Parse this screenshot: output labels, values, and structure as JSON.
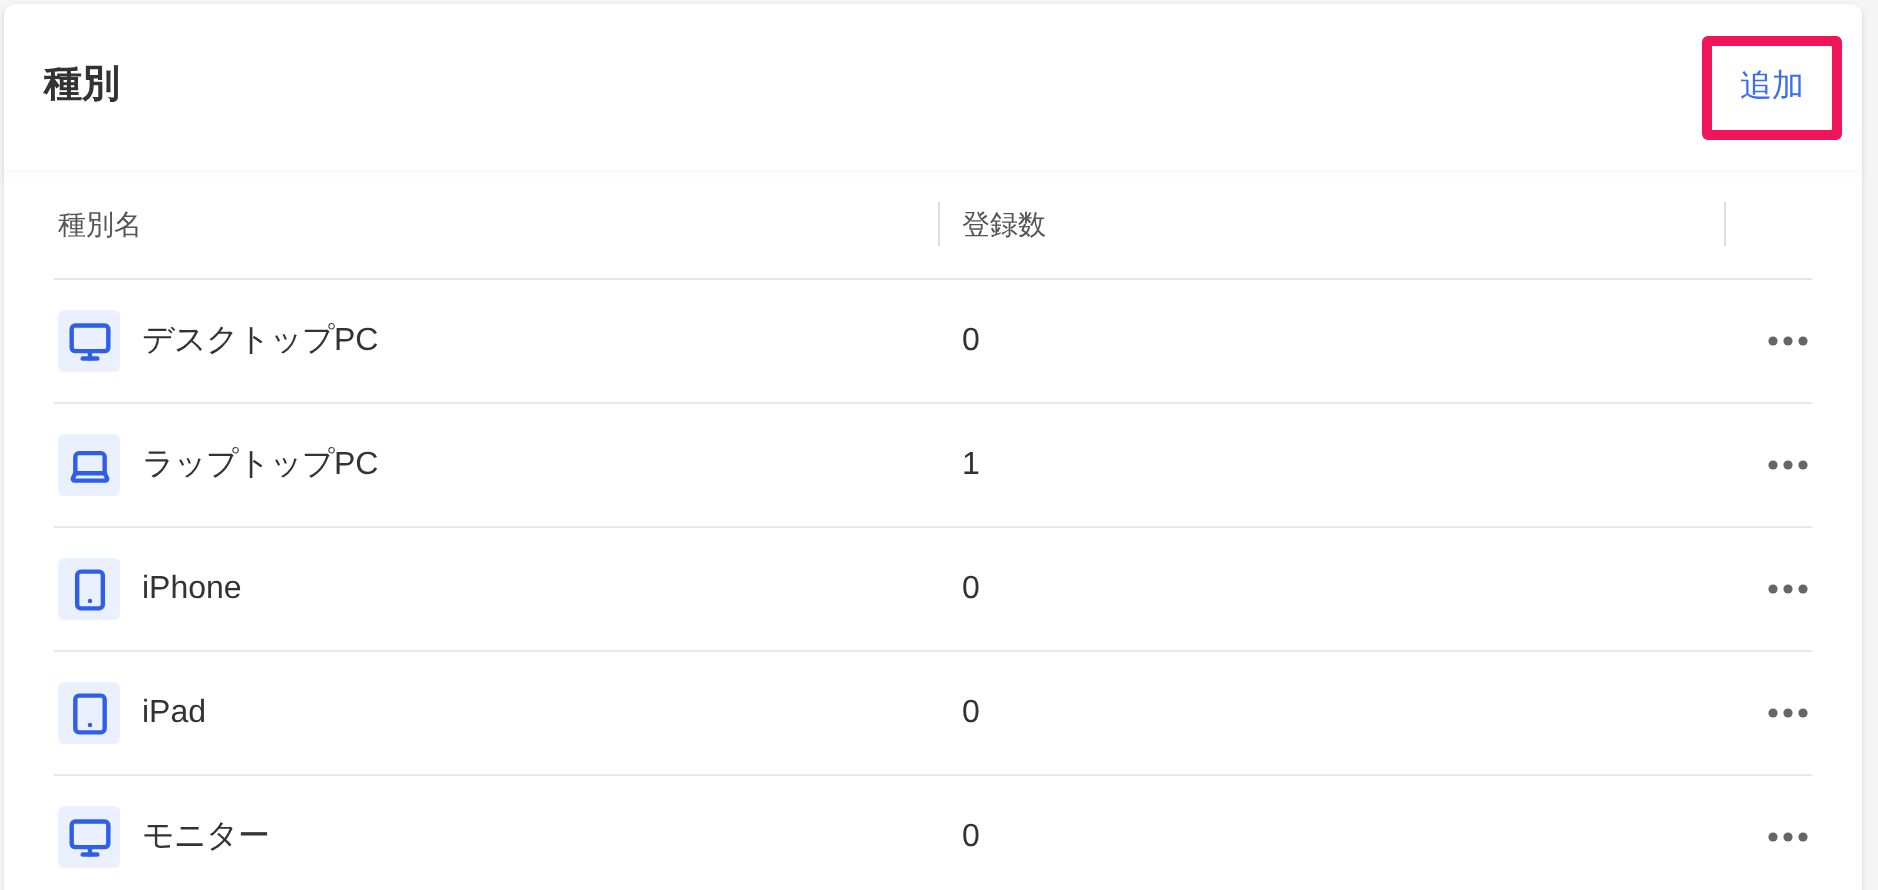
{
  "header": {
    "title": "種別",
    "add_button": {
      "label": "追加",
      "highlighted": true
    }
  },
  "table": {
    "columns": [
      "種別名",
      "登録数"
    ],
    "rows": [
      {
        "kind": "desktop",
        "name": "デスクトップPC",
        "count": "0"
      },
      {
        "kind": "laptop",
        "name": "ラップトップPC",
        "count": "1"
      },
      {
        "kind": "phone",
        "name": "iPhone",
        "count": "0"
      },
      {
        "kind": "tablet",
        "name": "iPad",
        "count": "0"
      },
      {
        "kind": "monitor",
        "name": "モニター",
        "count": "0"
      }
    ]
  }
}
